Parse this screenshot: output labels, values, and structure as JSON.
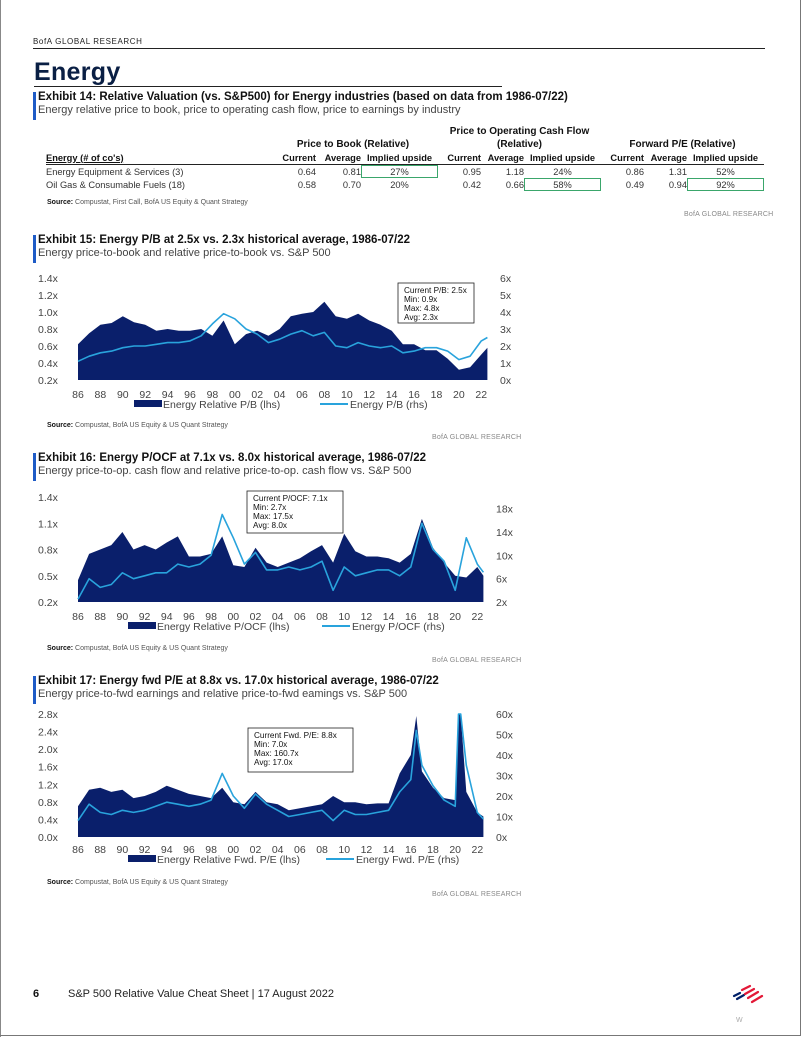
{
  "header": {
    "brand": "BofA GLOBAL RESEARCH",
    "section_title": "Energy"
  },
  "exhibit14": {
    "title": "Exhibit 14: Relative Valuation (vs. S&P500) for Energy industries (based on data from 1986-07/22)",
    "subtitle": "Energy relative price to book, price to operating cash flow, price to earnings by industry",
    "group_headers": [
      "Price to Book (Relative)",
      "Price to Operating Cash Flow",
      "(Relative)",
      "Forward P/E (Relative)"
    ],
    "row_header": "Energy (# of co's)",
    "columns": [
      "Current",
      "Average",
      "Implied upside",
      "Current",
      "Average",
      "Implied upside",
      "Current",
      "Average",
      "Implied upside"
    ],
    "rows": [
      {
        "name": "Energy Equipment & Services (3)",
        "values": [
          "0.64",
          "0.81",
          "27%",
          "0.95",
          "1.18",
          "24%",
          "0.86",
          "1.31",
          "52%"
        ],
        "highlight": [
          2,
          8
        ]
      },
      {
        "name": "Oil Gas & Consumable Fuels (18)",
        "values": [
          "0.58",
          "0.70",
          "20%",
          "0.42",
          "0.66",
          "58%",
          "0.49",
          "0.94",
          "92%"
        ],
        "highlight": [
          5,
          8
        ]
      }
    ],
    "source_label": "Source:",
    "source": "Compustat, First Call, BofA US Equity & Quant Strategy",
    "credit": "BofA GLOBAL RESEARCH"
  },
  "chart_data": [
    {
      "id": "exhibit15",
      "type": "area",
      "title": "Exhibit 15: Energy P/B at 2.5x vs. 2.3x historical average, 1986-07/22",
      "subtitle": "Energy price-to-book and relative price-to-book vs. S&P 500",
      "x": [
        1986,
        1987,
        1988,
        1989,
        1990,
        1991,
        1992,
        1993,
        1994,
        1995,
        1996,
        1997,
        1998,
        1999,
        2000,
        2001,
        2002,
        2003,
        2004,
        2005,
        2006,
        2007,
        2008,
        2009,
        2010,
        2011,
        2012,
        2013,
        2014,
        2015,
        2016,
        2017,
        2018,
        2019,
        2020,
        2021,
        2022,
        2022.55
      ],
      "x_ticks": [
        "86",
        "88",
        "90",
        "92",
        "94",
        "96",
        "98",
        "00",
        "02",
        "04",
        "06",
        "08",
        "10",
        "12",
        "14",
        "16",
        "18",
        "20",
        "22"
      ],
      "y_left": {
        "ticks": [
          "0.2x",
          "0.4x",
          "0.6x",
          "0.8x",
          "1.0x",
          "1.2x",
          "1.4x"
        ],
        "range": [
          0.2,
          1.4
        ]
      },
      "y_right": {
        "ticks": [
          "0x",
          "1x",
          "2x",
          "3x",
          "4x",
          "5x",
          "6x"
        ],
        "range": [
          0,
          6
        ]
      },
      "series": [
        {
          "name": "Energy Relative P/B (lhs)",
          "axis": "left",
          "kind": "area",
          "color": "#0a1f6b",
          "values": [
            0.62,
            0.75,
            0.85,
            0.87,
            0.95,
            0.88,
            0.85,
            0.78,
            0.8,
            0.78,
            0.78,
            0.8,
            0.72,
            0.9,
            0.62,
            0.74,
            0.78,
            0.72,
            0.8,
            0.95,
            0.98,
            1.0,
            1.12,
            0.95,
            0.92,
            0.98,
            0.9,
            0.85,
            0.78,
            0.62,
            0.62,
            0.55,
            0.55,
            0.45,
            0.32,
            0.35,
            0.5,
            0.58
          ]
        },
        {
          "name": "Energy P/B (rhs)",
          "axis": "right",
          "kind": "line",
          "color": "#29a3dc",
          "values": [
            1.1,
            1.4,
            1.6,
            1.7,
            1.9,
            2.0,
            2.0,
            2.1,
            2.2,
            2.2,
            2.3,
            2.6,
            3.3,
            3.9,
            3.6,
            3.0,
            2.7,
            2.2,
            2.4,
            2.7,
            2.9,
            2.6,
            2.8,
            2.0,
            1.9,
            2.2,
            2.0,
            1.9,
            2.0,
            1.6,
            1.7,
            1.9,
            1.9,
            1.7,
            1.2,
            1.4,
            2.3,
            2.5
          ]
        }
      ],
      "annotation": [
        "Current P/B: 2.5x",
        "Min: 0.9x",
        "Max: 4.8x",
        "Avg: 2.3x"
      ],
      "legend": [
        "Energy Relative P/B (lhs)",
        "Energy P/B (rhs)"
      ],
      "legend_position": "bottom",
      "source_label": "Source:",
      "source": "Compustat, BofA US Equity & US Quant Strategy",
      "credit": "BofA GLOBAL RESEARCH"
    },
    {
      "id": "exhibit16",
      "type": "area",
      "title": "Exhibit 16: Energy P/OCF at 7.1x vs. 8.0x historical average, 1986-07/22",
      "subtitle": "Energy price-to-op. cash flow and relative price-to-op. cash flow vs. S&P 500",
      "x": [
        1986,
        1987,
        1988,
        1989,
        1990,
        1991,
        1992,
        1993,
        1994,
        1995,
        1996,
        1997,
        1998,
        1999,
        2000,
        2001,
        2002,
        2003,
        2004,
        2005,
        2006,
        2007,
        2008,
        2009,
        2010,
        2011,
        2012,
        2013,
        2014,
        2015,
        2016,
        2017,
        2018,
        2019,
        2020,
        2021,
        2022,
        2022.55
      ],
      "x_ticks": [
        "86",
        "88",
        "90",
        "92",
        "94",
        "96",
        "98",
        "00",
        "02",
        "04",
        "06",
        "08",
        "10",
        "12",
        "14",
        "16",
        "18",
        "20",
        "22"
      ],
      "y_left": {
        "ticks": [
          "0.2x",
          "0.5x",
          "0.8x",
          "1.1x",
          "1.4x"
        ],
        "range": [
          0.2,
          1.4
        ]
      },
      "y_right": {
        "ticks": [
          "2x",
          "6x",
          "10x",
          "14x",
          "18x"
        ],
        "range": [
          2,
          20
        ]
      },
      "series": [
        {
          "name": "Energy Relative P/OCF (lhs)",
          "axis": "left",
          "kind": "area",
          "color": "#0a1f6b",
          "values": [
            0.45,
            0.75,
            0.8,
            0.85,
            1.0,
            0.8,
            0.85,
            0.8,
            0.88,
            0.95,
            0.72,
            0.72,
            0.75,
            0.95,
            0.62,
            0.6,
            0.82,
            0.65,
            0.6,
            0.65,
            0.7,
            0.78,
            0.85,
            0.65,
            0.98,
            0.78,
            0.72,
            0.72,
            0.7,
            0.65,
            0.75,
            1.15,
            0.82,
            0.65,
            0.5,
            0.48,
            0.6,
            0.5
          ]
        },
        {
          "name": "Energy P/OCF (rhs)",
          "axis": "right",
          "kind": "line",
          "color": "#29a3dc",
          "values": [
            2.5,
            6.0,
            4.5,
            5.0,
            7.0,
            6.0,
            6.5,
            7.0,
            7.0,
            8.5,
            8.0,
            8.5,
            10.0,
            17.0,
            13.0,
            8.5,
            10.5,
            7.5,
            7.5,
            8.0,
            7.5,
            8.0,
            9.0,
            4.0,
            8.0,
            6.5,
            7.0,
            7.5,
            7.5,
            6.5,
            8.0,
            15.5,
            11.0,
            9.0,
            4.0,
            13.0,
            8.5,
            7.1
          ]
        }
      ],
      "annotation": [
        "Current P/OCF: 7.1x",
        "Min: 2.7x",
        "Max: 17.5x",
        "Avg: 8.0x"
      ],
      "legend": [
        "Energy Relative P/OCF (lhs)",
        "Energy P/OCF (rhs)"
      ],
      "legend_position": "bottom",
      "source_label": "Source:",
      "source": "Compustat, BofA US Equity & US Quant Strategy",
      "credit": "BofA GLOBAL RESEARCH"
    },
    {
      "id": "exhibit17",
      "type": "area",
      "title": "Exhibit 17: Energy fwd P/E at 8.8x vs. 17.0x historical average, 1986-07/22",
      "subtitle": "Energy price-to-fwd earnings and relative price-to-fwd eamings vs. S&P 500",
      "x": [
        1986,
        1987,
        1988,
        1989,
        1990,
        1991,
        1992,
        1993,
        1994,
        1995,
        1996,
        1997,
        1998,
        1999,
        2000,
        2001,
        2002,
        2003,
        2004,
        2005,
        2006,
        2007,
        2008,
        2009,
        2010,
        2011,
        2012,
        2013,
        2014,
        2015,
        2016,
        2016.5,
        2017,
        2018,
        2019,
        2020,
        2020.3,
        2020.5,
        2021,
        2022,
        2022.55
      ],
      "x_ticks": [
        "86",
        "88",
        "90",
        "92",
        "94",
        "96",
        "98",
        "00",
        "02",
        "04",
        "06",
        "08",
        "10",
        "12",
        "14",
        "16",
        "18",
        "20",
        "22"
      ],
      "y_left": {
        "ticks": [
          "0.0x",
          "0.4x",
          "0.8x",
          "1.2x",
          "1.6x",
          "2.0x",
          "2.4x",
          "2.8x"
        ],
        "range": [
          0,
          3.0
        ]
      },
      "y_right": {
        "ticks": [
          "0x",
          "10x",
          "20x",
          "30x",
          "40x",
          "50x",
          "60x"
        ],
        "range": [
          0,
          60
        ]
      },
      "series": [
        {
          "name": "Energy Relative Fwd. P/E (lhs)",
          "axis": "left",
          "kind": "area",
          "color": "#0a1f6b",
          "values": [
            0.75,
            1.15,
            1.2,
            1.1,
            1.15,
            0.95,
            1.0,
            1.1,
            1.25,
            1.15,
            1.05,
            1.0,
            0.95,
            1.2,
            0.85,
            0.8,
            1.1,
            0.85,
            0.8,
            0.65,
            0.7,
            0.75,
            0.8,
            1.0,
            0.85,
            0.85,
            0.8,
            0.82,
            0.82,
            1.55,
            2.0,
            2.95,
            1.6,
            1.2,
            0.95,
            0.9,
            3.0,
            3.0,
            1.1,
            0.6,
            0.5
          ]
        },
        {
          "name": "Energy Fwd. P/E (rhs)",
          "axis": "right",
          "kind": "line",
          "color": "#29a3dc",
          "values": [
            8,
            16,
            12,
            11,
            13,
            12,
            13,
            15,
            17,
            16,
            15,
            16,
            18,
            31,
            20,
            14,
            21,
            16,
            13,
            10,
            11,
            12,
            13,
            8,
            13,
            11,
            11,
            12,
            13,
            22,
            28,
            52,
            35,
            25,
            18,
            15,
            60,
            60,
            35,
            12,
            8.8
          ]
        }
      ],
      "annotation": [
        "Current Fwd. P/E: 8.8x",
        "Min: 7.0x",
        "Max: 160.7x",
        "Avg: 17.0x"
      ],
      "legend": [
        "Energy Relative Fwd. P/E (lhs)",
        "Energy Fwd. P/E (rhs)"
      ],
      "legend_position": "bottom",
      "source_label": "Source:",
      "source": "Compustat, BofA US Equity & US Quant Strategy",
      "credit": "BofA GLOBAL RESEARCH"
    }
  ],
  "footer": {
    "page_number": "6",
    "document": "S&P 500 Relative Value Cheat Sheet | 17 August 2022",
    "mark": "W"
  },
  "colors": {
    "navy": "#0a1f6b",
    "light_blue": "#29a3dc",
    "accent_bar": "#1e5bc6",
    "highlight_box": "#3aa66b",
    "logo_red": "#e31837",
    "logo_blue": "#012169"
  }
}
